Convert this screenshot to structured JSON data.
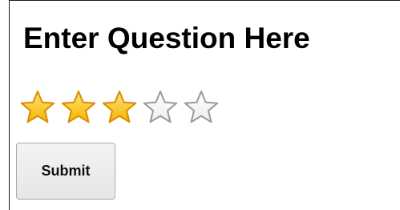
{
  "question": {
    "title": "Enter Question Here"
  },
  "rating": {
    "value": 3,
    "max": 5,
    "filled_color": "#f7b500",
    "filled_edge_color": "#d98e00",
    "empty_color": "#ffffff",
    "empty_edge_color": "#9a9a9a",
    "icon": "star-icon"
  },
  "form": {
    "submit_label": "Submit"
  }
}
